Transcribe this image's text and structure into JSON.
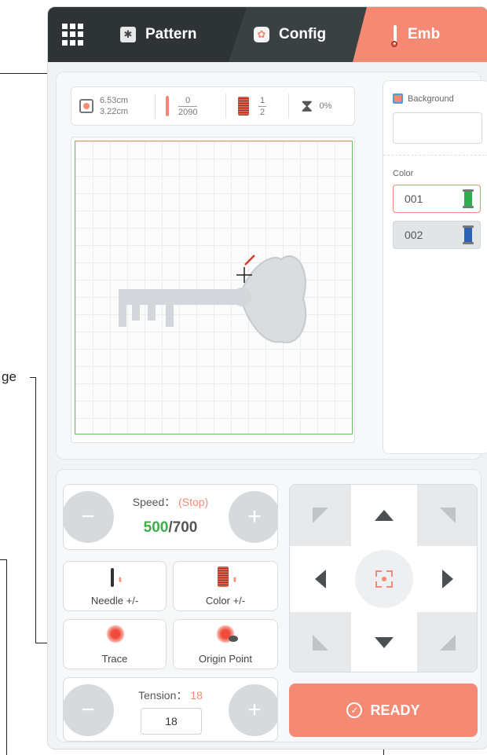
{
  "tabs": [
    {
      "label": "Pattern"
    },
    {
      "label": "Config"
    },
    {
      "label": "Emb"
    }
  ],
  "annotations": {
    "partial_label": "ge"
  },
  "info": {
    "width": "6.53cm",
    "height": "3.22cm",
    "stitch_current": "0",
    "stitch_total": "2090",
    "color_current": "1",
    "color_total": "2",
    "progress": "0%"
  },
  "side": {
    "background_label": "Background",
    "color_label": "Color",
    "colors": [
      {
        "code": "001",
        "hex": "#2fae4f",
        "selected": true
      },
      {
        "code": "002",
        "hex": "#2a62b8",
        "selected": false
      }
    ]
  },
  "controls": {
    "speed_label": "Speed：",
    "speed_state": "(Stop)",
    "speed_value": "500",
    "speed_slash": "/",
    "speed_max": "700",
    "minus": "−",
    "plus": "+",
    "needle_label": "Needle +/-",
    "color_label": "Color +/-",
    "trace_label": "Trace",
    "origin_label": "Origin Point",
    "tension_label": "Tension：",
    "tension_value": "18",
    "tension_input": "18",
    "ready_label": "READY"
  },
  "colors": {
    "accent": "#f58a74",
    "topbar": "#2e3436",
    "speed_green": "#3fae49",
    "hoop_border": "#6cc36b"
  }
}
